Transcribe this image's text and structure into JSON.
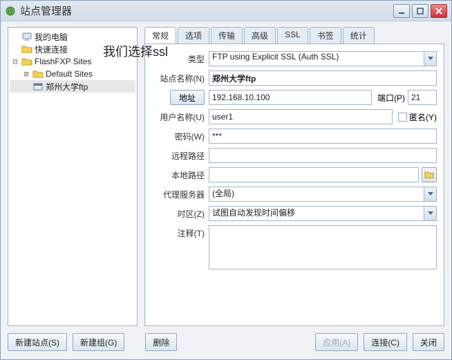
{
  "window": {
    "title": "站点管理器"
  },
  "annotation": "我们选择ssl",
  "tree": {
    "items": [
      {
        "label": "我的电脑",
        "icon": "computer"
      },
      {
        "label": "快速连接",
        "icon": "folder"
      },
      {
        "label": "FlashFXP Sites",
        "icon": "folder"
      },
      {
        "label": "Default Sites",
        "icon": "folder"
      },
      {
        "label": "郑州大学ftp",
        "icon": "site"
      }
    ]
  },
  "tabs": [
    "常规",
    "选项",
    "传输",
    "高级",
    "SSL",
    "书签",
    "统计"
  ],
  "active_tab": "常规",
  "form": {
    "type_label": "类型",
    "type_value": "FTP using Explicit SSL (Auth SSL)",
    "name_label": "站点名称(N)",
    "name_value": "郑州大学ftp",
    "addr_button": "地址",
    "addr_value": "192.168.10.100",
    "port_label": "端口(P)",
    "port_value": "21",
    "user_label": "用户名称(U)",
    "user_value": "user1",
    "anon_label": "匿名(Y)",
    "anon_checked": false,
    "pass_label": "密码(W)",
    "pass_value": "***",
    "remote_label": "远程路径",
    "remote_value": "",
    "local_label": "本地路径",
    "local_value": "",
    "proxy_label": "代理服务器",
    "proxy_value": "(全局)",
    "tz_label": "时区(Z)",
    "tz_value": "试图自动发现时间偏移",
    "notes_label": "注释(T)",
    "notes_value": ""
  },
  "buttons": {
    "new_site": "新建站点(S)",
    "new_group": "新建组(G)",
    "delete": "删除",
    "apply": "应用(A)",
    "connect": "连接(C)",
    "close": "关闭"
  }
}
